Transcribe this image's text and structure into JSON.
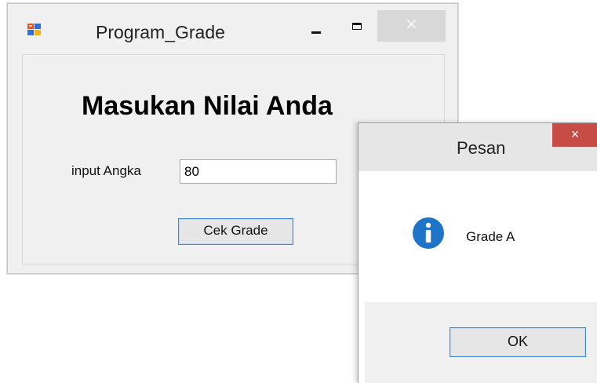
{
  "main_window": {
    "title": "Program_Grade",
    "heading": "Masukan Nilai Anda",
    "input_label": "input Angka",
    "input_value": "80",
    "button_label": "Cek Grade",
    "icons": {
      "app": "app-form-icon",
      "minimize": "minimize-icon",
      "maximize": "maximize-icon",
      "close": "close-icon"
    }
  },
  "message_box": {
    "title": "Pesan",
    "message": "Grade A",
    "ok_label": "OK",
    "close_glyph": "×",
    "icons": {
      "info": "info-icon",
      "close": "close-icon"
    }
  },
  "colors": {
    "close_button_red": "#c74c46",
    "info_blue": "#1e74c8",
    "button_border_blue": "#3c8ad8"
  }
}
